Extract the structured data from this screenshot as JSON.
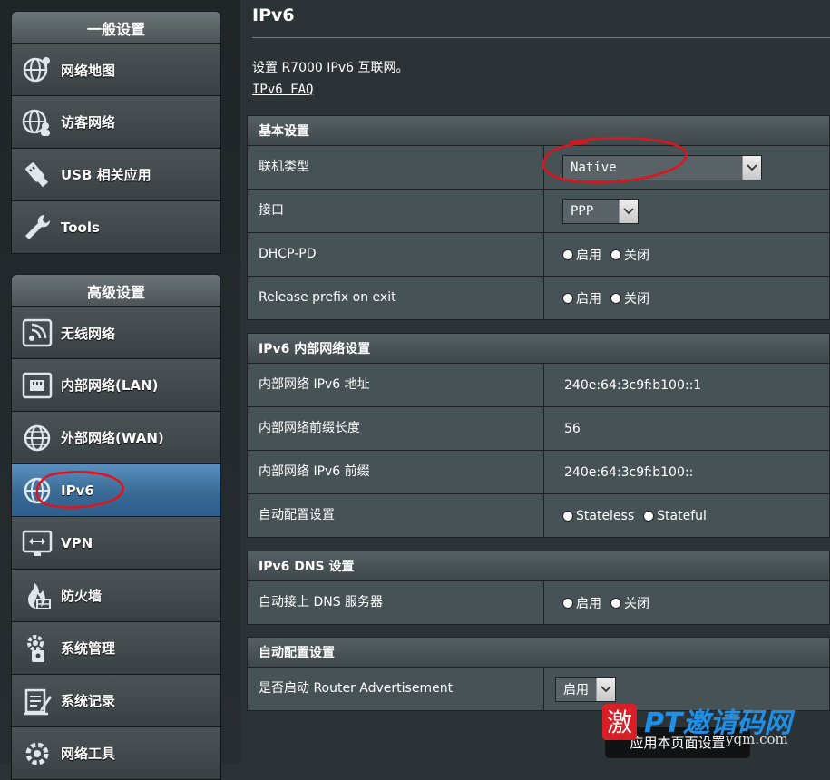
{
  "sidebar": {
    "general_header": "一般设置",
    "general_items": [
      {
        "label": "网络地图",
        "icon": "network-map-icon"
      },
      {
        "label": "访客网络",
        "icon": "guest-network-icon"
      },
      {
        "label": "USB 相关应用",
        "icon": "usb-icon"
      },
      {
        "label": "Tools",
        "icon": "wrench-icon"
      }
    ],
    "advanced_header": "高级设置",
    "advanced_items": [
      {
        "label": "无线网络",
        "icon": "wireless-icon"
      },
      {
        "label": "内部网络(LAN)",
        "icon": "lan-icon"
      },
      {
        "label": "外部网络(WAN)",
        "icon": "wan-globe-icon"
      },
      {
        "label": "IPv6",
        "icon": "ipv6-icon"
      },
      {
        "label": "VPN",
        "icon": "vpn-icon"
      },
      {
        "label": "防火墙",
        "icon": "firewall-icon"
      },
      {
        "label": "系统管理",
        "icon": "system-admin-icon"
      },
      {
        "label": "系统记录",
        "icon": "system-log-icon"
      },
      {
        "label": "网络工具",
        "icon": "network-tools-icon"
      }
    ],
    "active_item": "IPv6"
  },
  "main": {
    "title": "IPv6",
    "description": "设置 R7000 IPv6 互联网。",
    "faq_link": "IPv6 FAQ",
    "basic": {
      "header": "基本设置",
      "connection_type_label": "联机类型",
      "connection_type_value": "Native",
      "interface_label": "接口",
      "interface_value": "PPP",
      "dhcp_pd_label": "DHCP-PD",
      "release_prefix_label": "Release prefix on exit"
    },
    "lan": {
      "header": "IPv6 内部网络设置",
      "address_label": "内部网络 IPv6 地址",
      "address_value": "240e:64:3c9f:b100::1",
      "prefix_length_label": "内部网络前缀长度",
      "prefix_length_value": "56",
      "prefix_label": "内部网络 IPv6 前缀",
      "prefix_value": "240e:64:3c9f:b100::",
      "autoconfig_label": "自动配置设置",
      "stateless": "Stateless",
      "stateful": "Stateful"
    },
    "dns": {
      "header": "IPv6 DNS 设置",
      "auto_dns_label": "自动接上 DNS 服务器"
    },
    "autoconf": {
      "header": "自动配置设置",
      "router_adv_label": "是否启动 Router Advertisement",
      "router_adv_value": "启用"
    },
    "radio_enable": "启用",
    "radio_disable": "关闭",
    "apply_button": "应用本页面设置"
  },
  "watermark": {
    "text": "PT邀请码网",
    "url": "yqm.com"
  }
}
